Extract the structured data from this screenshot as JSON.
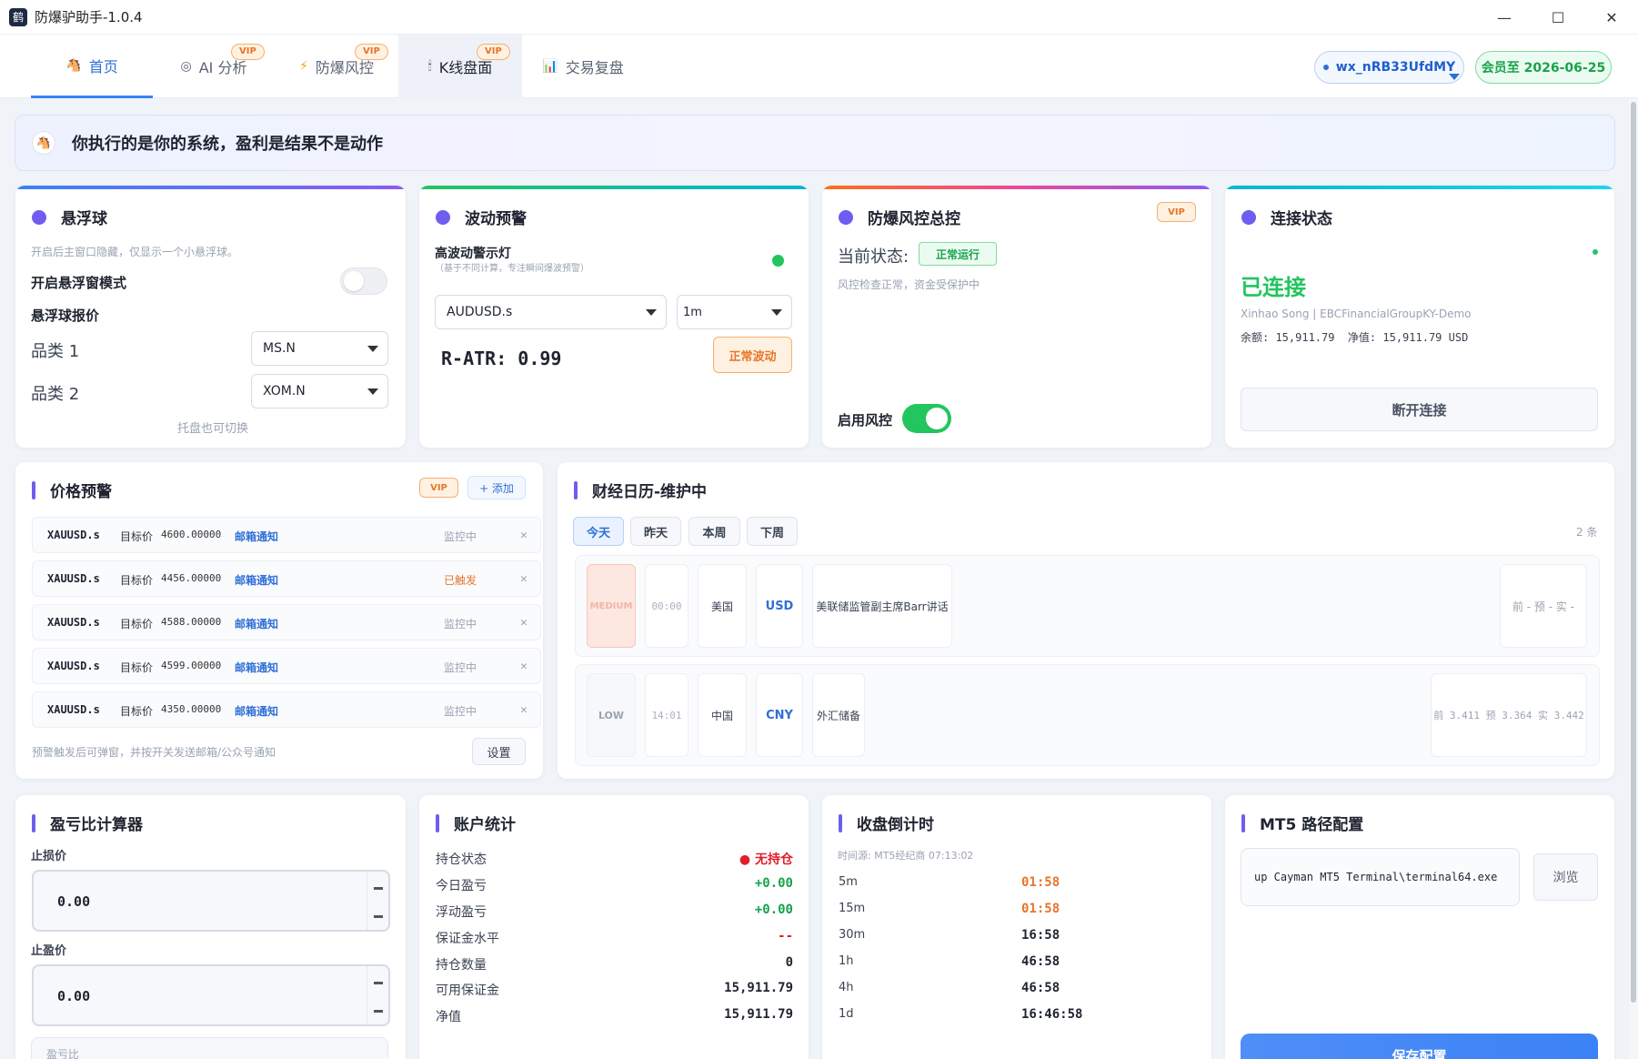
{
  "window": {
    "title": "防爆驴助手-1.0.4",
    "app_icon": "鹤",
    "minimize": "—",
    "maximize": "☐",
    "close": "✕"
  },
  "nav": {
    "tabs": [
      {
        "label": "首页",
        "icon": "🐴"
      },
      {
        "label": "AI 分析",
        "icon": "◎",
        "badge": "VIP"
      },
      {
        "label": "防爆风控",
        "icon": "⚡",
        "badge": "VIP"
      },
      {
        "label": "K线盘面",
        "icon": "🕯",
        "badge": "VIP"
      },
      {
        "label": "交易复盘",
        "icon": "📊"
      }
    ],
    "user": "wx_nRB33UfdMY",
    "membership": "会员至 2026-06-25"
  },
  "banner": {
    "text": "你执行的是你的系统，盈利是结果不是动作",
    "icon": "🐴"
  },
  "float_ball": {
    "title": "悬浮球",
    "hint": "开启后主窗口隐藏，仅显示一个小悬浮球。",
    "mode_label": "开启悬浮窗模式",
    "mode_on": false,
    "quote_label": "悬浮球报价",
    "cat1_label": "品类 1",
    "cat1_value": "MS.N",
    "cat2_label": "品类 2",
    "cat2_value": "XOM.N",
    "footer": "托盘也可切换"
  },
  "volatility": {
    "title": "波动预警",
    "light_label": "高波动警示灯",
    "light_hint": "（基于不同计算，专注瞬间爆波预警）",
    "light_color": "#22c55e",
    "symbol": "AUDUSD.s",
    "timeframe": "1m",
    "ratr": "R-ATR: 0.99",
    "status": "正常波动"
  },
  "risk": {
    "title": "防爆风控总控",
    "badge": "VIP",
    "state_label": "当前状态:",
    "state_value": "正常运行",
    "desc": "风控检查正常，资金受保护中",
    "enable_label": "启用风控",
    "enabled": true
  },
  "connection": {
    "title": "连接状态",
    "status": "已连接",
    "account": "Xinhao Song | EBCFinancialGroupKY-Demo",
    "balance": "余额: 15,911.79  净值: 15,911.79 USD",
    "disconnect": "断开连接"
  },
  "price_alert": {
    "title": "价格预警",
    "badge": "VIP",
    "add": "+ 添加",
    "rows": [
      {
        "symbol": "XAUUSD.s",
        "label": "目标价",
        "price": "4600.00000",
        "notify": "邮箱通知",
        "status": "监控中",
        "triggered": false
      },
      {
        "symbol": "XAUUSD.s",
        "label": "目标价",
        "price": "4456.00000",
        "notify": "邮箱通知",
        "status": "已触发",
        "triggered": true
      },
      {
        "symbol": "XAUUSD.s",
        "label": "目标价",
        "price": "4588.00000",
        "notify": "邮箱通知",
        "status": "监控中",
        "triggered": false
      },
      {
        "symbol": "XAUUSD.s",
        "label": "目标价",
        "price": "4599.00000",
        "notify": "邮箱通知",
        "status": "监控中",
        "triggered": false
      },
      {
        "symbol": "XAUUSD.s",
        "label": "目标价",
        "price": "4350.00000",
        "notify": "邮箱通知",
        "status": "监控中",
        "triggered": false
      }
    ],
    "footer": "预警触发后可弹窗，并按开关发送邮箱/公众号通知",
    "settings": "设置"
  },
  "calendar": {
    "title": "财经日历-维护中",
    "tabs": [
      "今天",
      "昨天",
      "本周",
      "下周"
    ],
    "count": "2 条",
    "events": [
      {
        "level": "MEDIUM",
        "time": "00:00",
        "country": "美国",
        "currency": "USD",
        "name": "美联储监管副主席Barr讲话",
        "values": "前 - 预 - 实 -"
      },
      {
        "level": "LOW",
        "time": "14:01",
        "country": "中国",
        "currency": "CNY",
        "name": "外汇储备",
        "values": "前 3.411 预 3.364 实 3.442"
      }
    ]
  },
  "calculator": {
    "title": "盈亏比计算器",
    "stop_loss_label": "止损价",
    "stop_loss": "0.00",
    "take_profit_label": "止盈价",
    "take_profit": "0.00",
    "ratio_label": "盈亏比"
  },
  "stats": {
    "title": "账户统计",
    "rows": [
      {
        "label": "持仓状态",
        "value": "● 无持仓",
        "color": "#e11d2a"
      },
      {
        "label": "今日盈亏",
        "value": "+0.00",
        "color": "#16a34a"
      },
      {
        "label": "浮动盈亏",
        "value": "+0.00",
        "color": "#16a34a"
      },
      {
        "label": "保证金水平",
        "value": "--",
        "color": "#e11d2a"
      },
      {
        "label": "持仓数量",
        "value": "0",
        "color": "#1f2430"
      },
      {
        "label": "可用保证金",
        "value": "15,911.79",
        "color": "#1f2430"
      },
      {
        "label": "净值",
        "value": "15,911.79",
        "color": "#1f2430"
      }
    ]
  },
  "countdown": {
    "title": "收盘倒计时",
    "source": "时间源: MT5经纪商 07:13:02",
    "rows": [
      {
        "tf": "5m",
        "left": "01:58",
        "hot": true
      },
      {
        "tf": "15m",
        "left": "01:58",
        "hot": true
      },
      {
        "tf": "30m",
        "left": "16:58",
        "hot": false
      },
      {
        "tf": "1h",
        "left": "46:58",
        "hot": false
      },
      {
        "tf": "4h",
        "left": "46:58",
        "hot": false
      },
      {
        "tf": "1d",
        "left": "16:46:58",
        "hot": false
      }
    ]
  },
  "mt5": {
    "title": "MT5 路径配置",
    "path": "up Cayman MT5 Terminal\\terminal64.exe",
    "browse": "浏览",
    "save": "保存配置"
  }
}
